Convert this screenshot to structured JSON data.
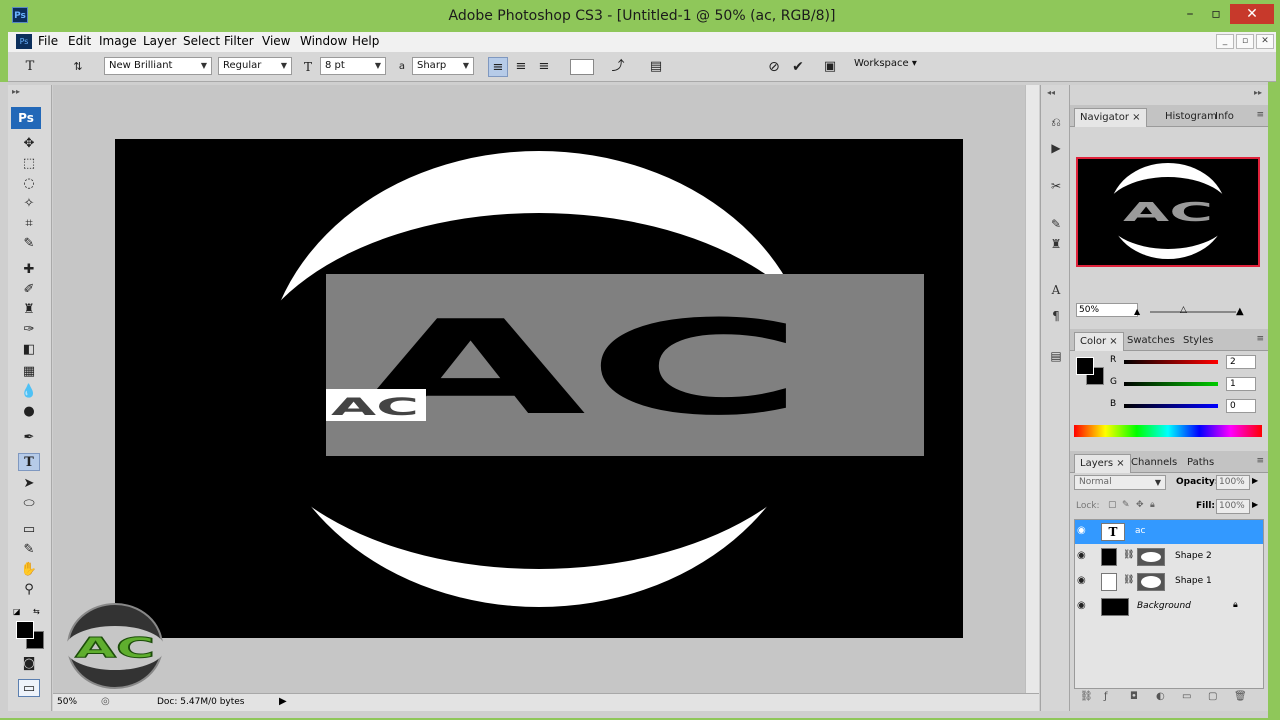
{
  "app": {
    "title": "Adobe Photoshop CS3 - [Untitled-1 @ 50% (ac, RGB/8)]",
    "icon": "Ps"
  },
  "menu": [
    "File",
    "Edit",
    "Image",
    "Layer",
    "Select",
    "Filter",
    "View",
    "Window",
    "Help"
  ],
  "options": {
    "font_family": "New Brilliant",
    "font_style": "Regular",
    "font_size": "8 pt",
    "antialias_label": "a",
    "antialias": "Sharp",
    "workspace": "Workspace"
  },
  "status": {
    "zoom": "50%",
    "doc": "Doc: 5.47M/0 bytes"
  },
  "canvas": {
    "text": "AC",
    "small_text": "AC"
  },
  "navigator": {
    "tabs": [
      "Navigator",
      "Histogram",
      "Info"
    ],
    "zoom": "50%",
    "preview_text": "AC"
  },
  "color": {
    "tabs": [
      "Color",
      "Swatches",
      "Styles"
    ],
    "channels": [
      {
        "label": "R",
        "value": "2"
      },
      {
        "label": "G",
        "value": "1"
      },
      {
        "label": "B",
        "value": "0"
      }
    ]
  },
  "layers": {
    "tabs": [
      "Layers",
      "Channels",
      "Paths"
    ],
    "blend": "Normal",
    "opacity_label": "Opacity:",
    "opacity": "100%",
    "lock_label": "Lock:",
    "fill_label": "Fill:",
    "fill": "100%",
    "items": [
      {
        "name": "ac",
        "type": "text",
        "selected": true
      },
      {
        "name": "Shape 2",
        "type": "shape"
      },
      {
        "name": "Shape 1",
        "type": "shape"
      },
      {
        "name": "Background",
        "type": "background"
      }
    ]
  },
  "watermark": "AC",
  "colors": {
    "accent": "#8fc75a",
    "selection": "#3399ff",
    "close": "#c7392b"
  }
}
